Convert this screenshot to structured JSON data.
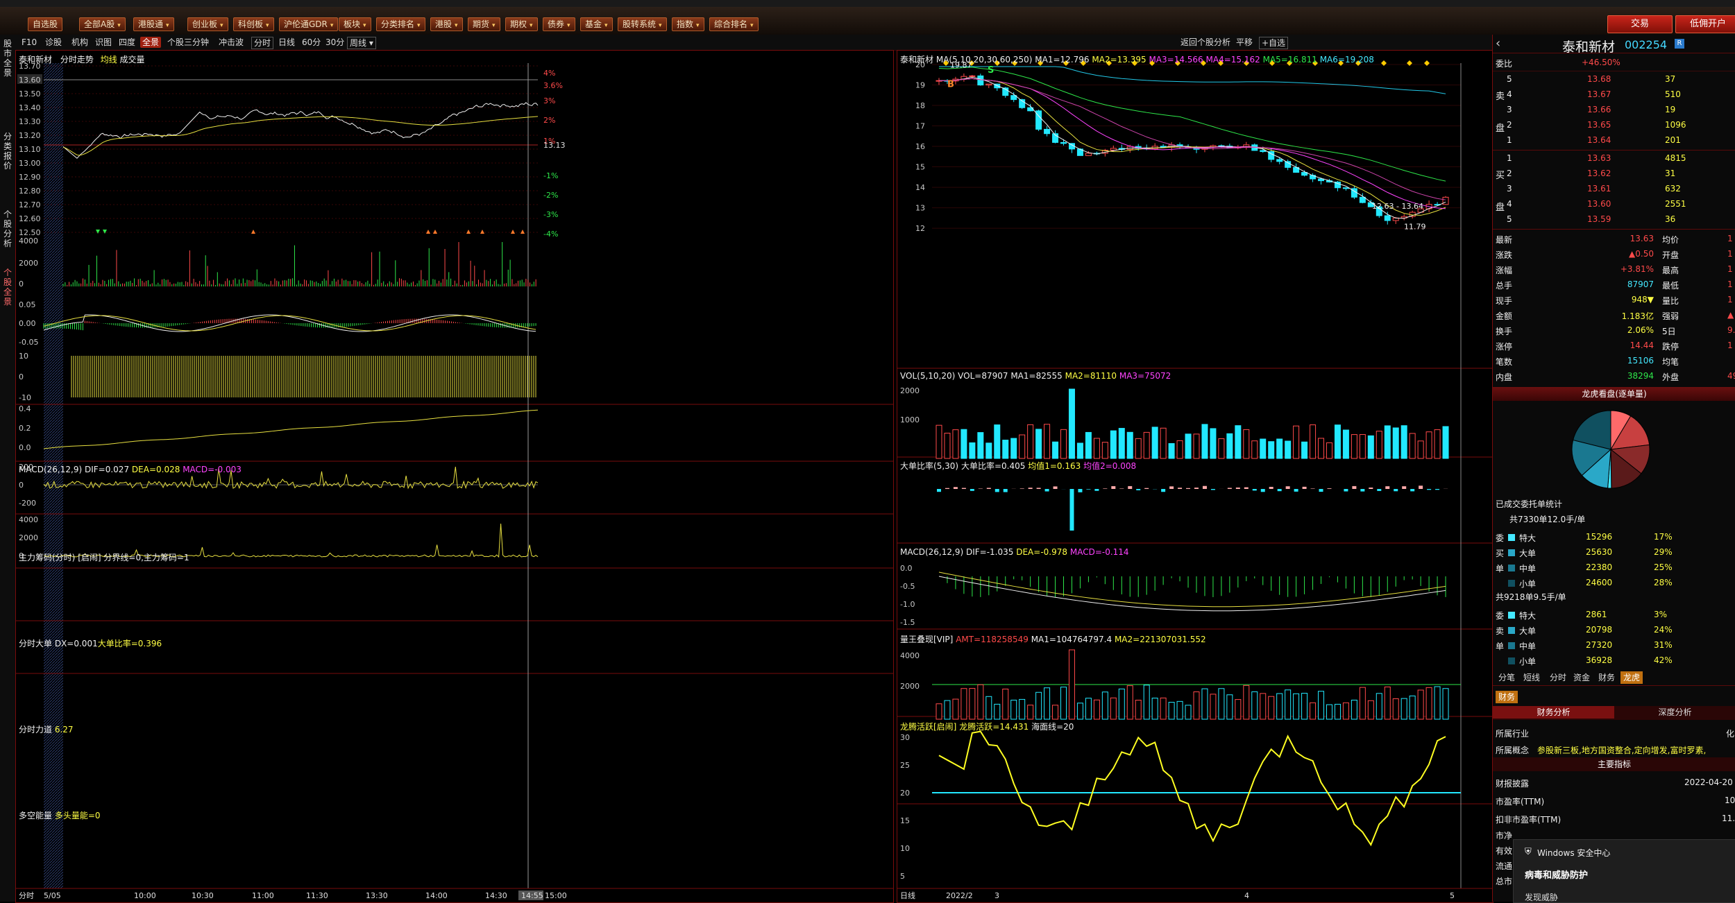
{
  "menu": {
    "items": [
      "自选股",
      "全部A股",
      "港股通",
      "创业板",
      "科创板",
      "沪伦通GDR",
      "板块",
      "分类排名",
      "港股",
      "期货",
      "期权",
      "债券",
      "基金",
      "股转系统",
      "指数",
      "综合排名"
    ],
    "trade_label": "交易",
    "margin_label": "低佣开户"
  },
  "left_tabs": [
    "股市全景",
    "分类报价",
    "个股分析",
    "个股全景"
  ],
  "toolbar": {
    "items": [
      "F10",
      "诊股",
      "机构",
      "识图",
      "四度",
      "全景",
      "个股三分钟",
      "冲击波",
      "分时",
      "日线",
      "60分",
      "30分",
      "周线"
    ],
    "period_dropdown": "周线",
    "back_label": "返回个股分析",
    "flat_label": "平移",
    "watch_label": "+自选"
  },
  "intraday": {
    "title": "泰和新材",
    "mode": "分时走势",
    "line_label": "均线",
    "vol_label": "成交量",
    "price_ticks": [
      "13.70",
      "13.60",
      "13.50",
      "13.40",
      "13.30",
      "13.20",
      "13.10",
      "13.00",
      "12.90",
      "12.80",
      "12.70",
      "12.60",
      "12.50"
    ],
    "pct_ticks": [
      "4%",
      "3.6%",
      "3%",
      "2%",
      "1%",
      "13.13",
      "-1%",
      "-2%",
      "-3%",
      "-4%"
    ],
    "price_highlight": "13.60",
    "vol_ticks": [
      "4000",
      "2000",
      "0"
    ],
    "macd_label": "MACD",
    "macd_params": "(26,12,9)",
    "macd_dif": "DIF=0.027",
    "macd_dea": "DEA=0.028",
    "macd_val": "MACD=-0.003",
    "macd_ticks": [
      "0.05",
      "0.00",
      "-0.05"
    ],
    "chip_label": "主力筹码(分时)",
    "chip_hint": "[启闹]",
    "chip_vals": "分界线=0,主力筹码=1",
    "chip_ticks": [
      "10",
      "0",
      "-10"
    ],
    "big_label": "分时大单",
    "big_dx": "DX=0.001",
    "big_ratio": "大单比率=0.396",
    "big_ticks": [
      "0.4",
      "0.2",
      "0.0"
    ],
    "force_label": "分时力道",
    "force_val": "6.27",
    "force_ticks": [
      "200",
      "0",
      "-200"
    ],
    "energy_label": "多空能量",
    "energy_val": "多头量能=0",
    "energy_ticks": [
      "4000",
      "2000",
      "0"
    ],
    "time_axis_label": "分时",
    "date": "5/05",
    "times": [
      "10:00",
      "10:30",
      "11:00",
      "11:30",
      "13:30",
      "14:00",
      "14:30",
      "14:55",
      "15:00"
    ]
  },
  "kline": {
    "title": "泰和新材",
    "ma_label": "MA",
    "ma_params": "(5,10,20,30,60,250)",
    "ma_vals": [
      "MA1=12.796",
      "MA2=13.395",
      "MA3=14.566",
      "MA4=15.162",
      "MA5=16.811",
      "MA6=19.208"
    ],
    "price_ticks": [
      "20",
      "19",
      "18",
      "17",
      "16",
      "15",
      "14",
      "13",
      "12"
    ],
    "high_mark": "19.87",
    "low_mark": "11.79",
    "range_label": "12.63 - 13.64",
    "vol_label": "VOL",
    "vol_params": "(5,10,20)",
    "vol_vals": [
      "VOL=87907",
      "MA1=82555",
      "MA2=81110",
      "MA3=75072"
    ],
    "vol_ticks": [
      "2000",
      "1000"
    ],
    "big_label": "大单比率",
    "big_params": "(5,30)",
    "big_vals": [
      "大单比率=0.405",
      "均值1=0.163",
      "均值2=0.008"
    ],
    "macd_label": "MACD",
    "macd_params": "(26,12,9)",
    "macd_vals": [
      "DIF=-1.035",
      "DEA=-0.978",
      "MACD=-0.114"
    ],
    "macd_ticks": [
      "0.0",
      "-0.5",
      "-1.0",
      "-1.5"
    ],
    "amt_label": "量王叠现[VIP]",
    "amt_vals": [
      "AMT=118258549",
      "MA1=104764797.4",
      "MA2=221307031.552"
    ],
    "amt_ticks": [
      "4000",
      "2000"
    ],
    "act_label": "龙腾活跃[启闹]",
    "act_vals": [
      "龙腾活跃=14.431",
      "海面线=20"
    ],
    "act_ticks": [
      "30",
      "25",
      "20",
      "15",
      "10",
      "5"
    ],
    "axis_label": "日线",
    "dates": [
      "2022/2",
      "3",
      "4",
      "5"
    ]
  },
  "quote": {
    "name": "泰和新材",
    "code": "002254",
    "ratio_label": "委比",
    "ratio_val": "+46.50%",
    "asks": [
      {
        "lvl": "5",
        "price": "13.68",
        "vol": "37"
      },
      {
        "lvl": "4",
        "price": "13.67",
        "vol": "510"
      },
      {
        "lvl": "3",
        "price": "13.66",
        "vol": "19"
      },
      {
        "lvl": "2",
        "price": "13.65",
        "vol": "1096"
      },
      {
        "lvl": "1",
        "price": "13.64",
        "vol": "201"
      }
    ],
    "bids": [
      {
        "lvl": "1",
        "price": "13.63",
        "vol": "4815"
      },
      {
        "lvl": "2",
        "price": "13.62",
        "vol": "31"
      },
      {
        "lvl": "3",
        "price": "13.61",
        "vol": "632"
      },
      {
        "lvl": "4",
        "price": "13.60",
        "vol": "2551"
      },
      {
        "lvl": "5",
        "price": "13.59",
        "vol": "36"
      }
    ],
    "ask_side": [
      "卖",
      "盘"
    ],
    "bid_side": [
      "买",
      "盘"
    ],
    "stats": [
      {
        "l": "最新",
        "v": "13.63",
        "l2": "均价",
        "cls": "red"
      },
      {
        "l": "涨跌",
        "v": "▲0.50",
        "l2": "开盘",
        "cls": "red"
      },
      {
        "l": "涨幅",
        "v": "+3.81%",
        "l2": "最高",
        "cls": "red"
      },
      {
        "l": "总手",
        "v": "87907",
        "l2": "最低",
        "cls": "cyan"
      },
      {
        "l": "现手",
        "v": "948▼",
        "l2": "量比",
        "cls": "yel"
      },
      {
        "l": "金额",
        "v": "1.183亿",
        "l2": "强弱",
        "cls": "yel"
      },
      {
        "l": "换手",
        "v": "2.06%",
        "l2": "5日",
        "cls": "yel"
      },
      {
        "l": "涨停",
        "v": "14.44",
        "l2": "跌停",
        "cls": "red"
      },
      {
        "l": "笔数",
        "v": "15106",
        "l2": "均笔",
        "cls": "cyan"
      },
      {
        "l": "内盘",
        "v": "38294",
        "l2": "外盘",
        "cls": "green"
      }
    ],
    "stat_right": [
      "1",
      "1",
      "1",
      "1",
      "1",
      "▲",
      "9.",
      "1",
      "",
      "49"
    ],
    "dragon_header": "龙虎看盘(逐单量)",
    "deal_stat": "已成交委托单统计",
    "buy_total": "共7330单12.0手/单",
    "buy_side": [
      "委",
      "买",
      "单"
    ],
    "buy_rows": [
      {
        "t": "特大",
        "v": "15296",
        "p": "17%"
      },
      {
        "t": "大单",
        "v": "25630",
        "p": "29%"
      },
      {
        "t": "中单",
        "v": "22380",
        "p": "25%"
      },
      {
        "t": "小单",
        "v": "24600",
        "p": "28%"
      }
    ],
    "sell_total": "共9218单9.5手/单",
    "sell_side": [
      "委",
      "卖",
      "单"
    ],
    "sell_rows": [
      {
        "t": "特大",
        "v": "2861",
        "p": "3%"
      },
      {
        "t": "大单",
        "v": "20798",
        "p": "24%"
      },
      {
        "t": "中单",
        "v": "27320",
        "p": "31%"
      },
      {
        "t": "小单",
        "v": "36928",
        "p": "42%"
      }
    ],
    "tabs": [
      "分笔",
      "短线",
      "分时",
      "资金",
      "财务",
      "龙虎"
    ],
    "fin_tab": "财务",
    "fin_subtabs": [
      "财务分析",
      "深度分析"
    ],
    "industry_label": "所属行业",
    "industry_val": "化",
    "concept_label": "所属概念",
    "concept_val": "参股新三板,地方国资整合,定向增发,富时罗素,",
    "main_idx": "主要指标",
    "report_label": "财报披露",
    "report_val": "2022-04-20",
    "pe_label": "市盈率(TTM)",
    "pe_val": "10",
    "pe2_label": "扣非市盈率(TTM)",
    "pe2_val": "11.",
    "extra_labels": [
      "市净",
      "有效",
      "流通",
      "总市"
    ]
  },
  "popup": {
    "title": "Windows 安全中心",
    "body": "病毒和威胁防护",
    "more": "发现威胁"
  }
}
